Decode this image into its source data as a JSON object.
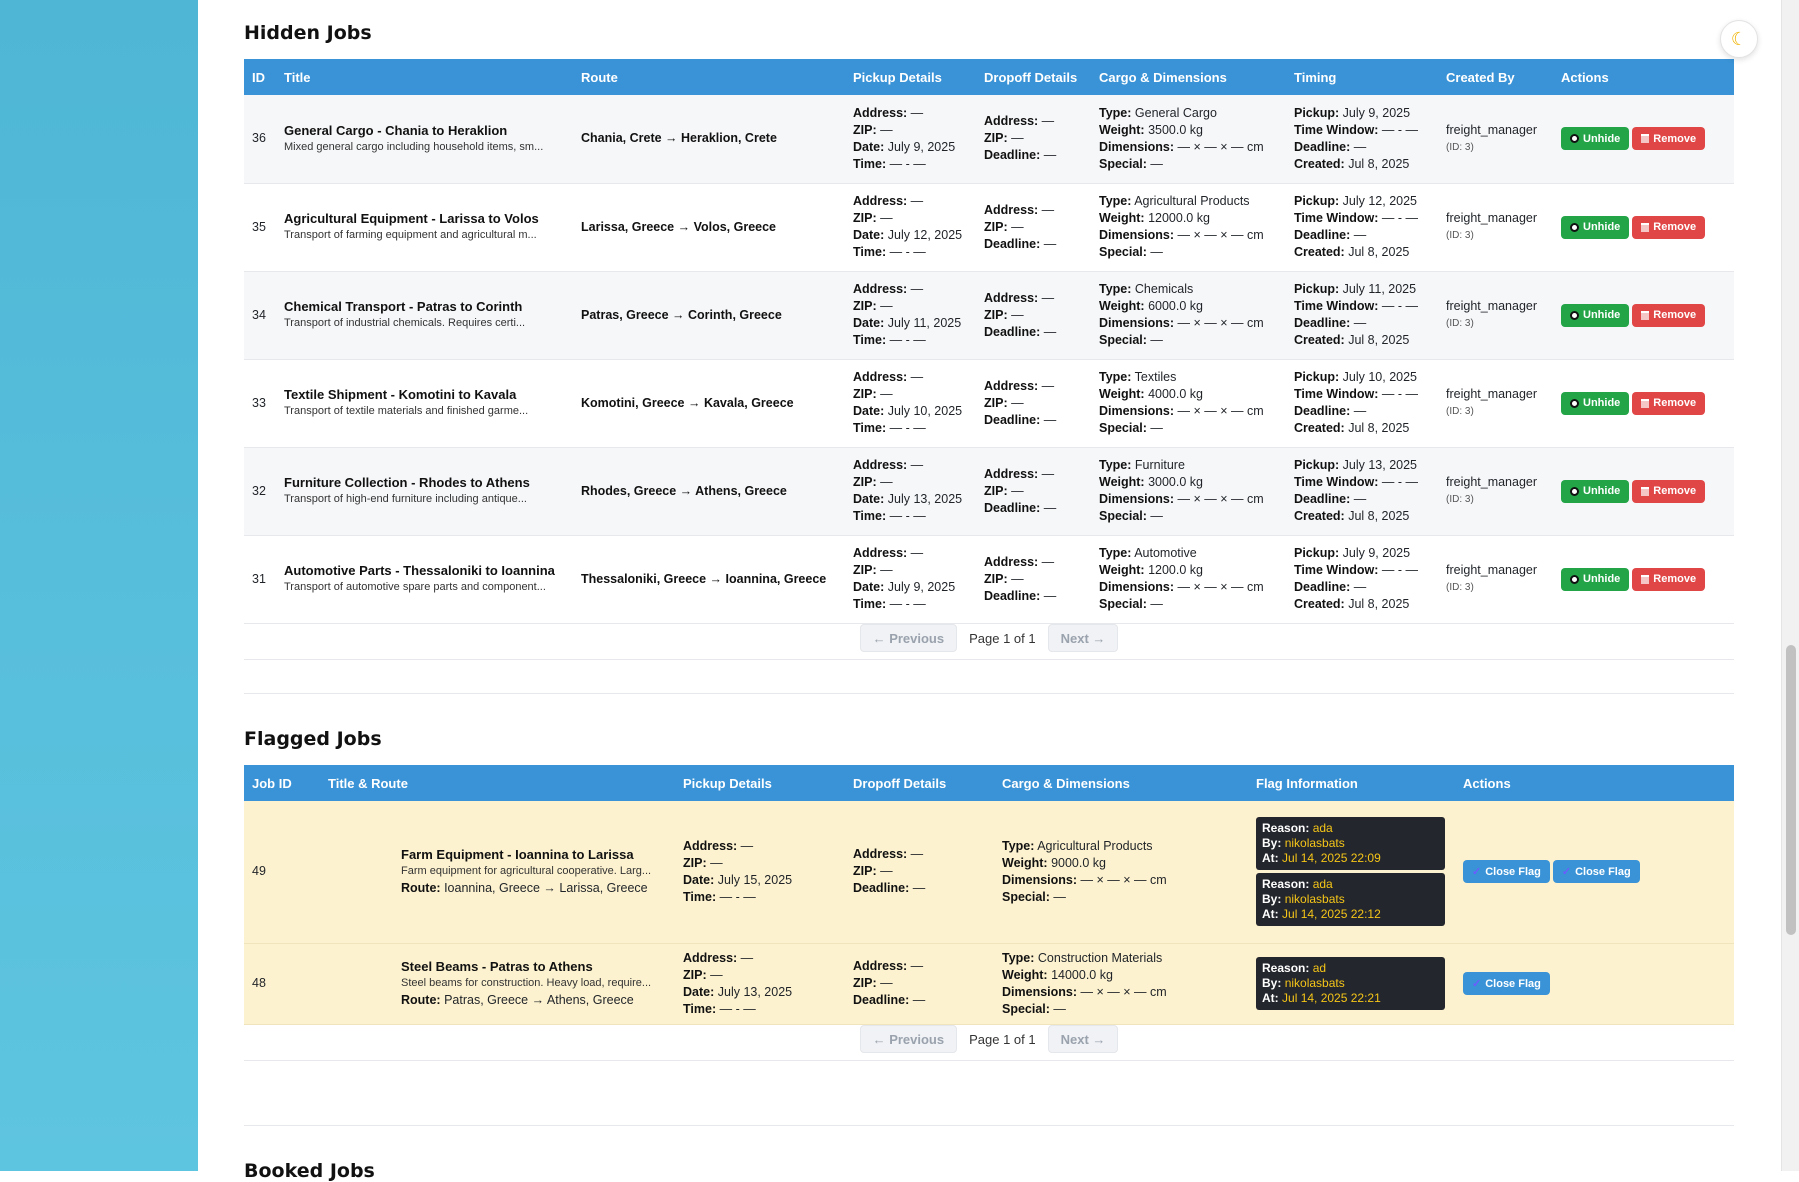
{
  "theme_toggle_icon": "moon-icon",
  "hidden_jobs": {
    "title": "Hidden Jobs",
    "columns": [
      "ID",
      "Title",
      "Route",
      "Pickup Details",
      "Dropoff Details",
      "Cargo & Dimensions",
      "Timing",
      "Created By",
      "Actions"
    ],
    "labels": {
      "address": "Address:",
      "zip": "ZIP:",
      "date": "Date:",
      "time": "Time:",
      "deadline": "Deadline:",
      "type": "Type:",
      "weight": "Weight:",
      "dimensions": "Dimensions:",
      "special": "Special:",
      "pickup": "Pickup:",
      "time_window": "Time Window:",
      "created": "Created:"
    },
    "rows": [
      {
        "id": "36",
        "title": "General Cargo - Chania to Heraklion",
        "desc": "Mixed general cargo including household items, sm...",
        "route": "Chania, Crete → Heraklion, Crete",
        "pickup": {
          "address": "—",
          "zip": "—",
          "date": "July 9, 2025",
          "time": "— - —"
        },
        "dropoff": {
          "address": "—",
          "zip": "—",
          "deadline": "—"
        },
        "cargo": {
          "type": "General Cargo",
          "weight": "3500.0 kg",
          "dimensions": "— × — × — cm",
          "special": "—"
        },
        "timing": {
          "pickup": "July 9, 2025",
          "time_window": "— - —",
          "deadline": "—",
          "created": "Jul 8, 2025"
        },
        "created_by": "freight_manager",
        "creator_id": "(ID: 3)"
      },
      {
        "id": "35",
        "title": "Agricultural Equipment - Larissa to Volos",
        "desc": "Transport of farming equipment and agricultural m...",
        "route": "Larissa, Greece → Volos, Greece",
        "pickup": {
          "address": "—",
          "zip": "—",
          "date": "July 12, 2025",
          "time": "— - —"
        },
        "dropoff": {
          "address": "—",
          "zip": "—",
          "deadline": "—"
        },
        "cargo": {
          "type": "Agricultural Products",
          "weight": "12000.0 kg",
          "dimensions": "— × — × — cm",
          "special": "—"
        },
        "timing": {
          "pickup": "July 12, 2025",
          "time_window": "— - —",
          "deadline": "—",
          "created": "Jul 8, 2025"
        },
        "created_by": "freight_manager",
        "creator_id": "(ID: 3)"
      },
      {
        "id": "34",
        "title": "Chemical Transport - Patras to Corinth",
        "desc": "Transport of industrial chemicals. Requires certi...",
        "route": "Patras, Greece → Corinth, Greece",
        "pickup": {
          "address": "—",
          "zip": "—",
          "date": "July 11, 2025",
          "time": "— - —"
        },
        "dropoff": {
          "address": "—",
          "zip": "—",
          "deadline": "—"
        },
        "cargo": {
          "type": "Chemicals",
          "weight": "6000.0 kg",
          "dimensions": "— × — × — cm",
          "special": "—"
        },
        "timing": {
          "pickup": "July 11, 2025",
          "time_window": "— - —",
          "deadline": "—",
          "created": "Jul 8, 2025"
        },
        "created_by": "freight_manager",
        "creator_id": "(ID: 3)"
      },
      {
        "id": "33",
        "title": "Textile Shipment - Komotini to Kavala",
        "desc": "Transport of textile materials and finished garme...",
        "route": "Komotini, Greece → Kavala, Greece",
        "pickup": {
          "address": "—",
          "zip": "—",
          "date": "July 10, 2025",
          "time": "— - —"
        },
        "dropoff": {
          "address": "—",
          "zip": "—",
          "deadline": "—"
        },
        "cargo": {
          "type": "Textiles",
          "weight": "4000.0 kg",
          "dimensions": "— × — × — cm",
          "special": "—"
        },
        "timing": {
          "pickup": "July 10, 2025",
          "time_window": "— - —",
          "deadline": "—",
          "created": "Jul 8, 2025"
        },
        "created_by": "freight_manager",
        "creator_id": "(ID: 3)"
      },
      {
        "id": "32",
        "title": "Furniture Collection - Rhodes to Athens",
        "desc": "Transport of high-end furniture including antique...",
        "route": "Rhodes, Greece → Athens, Greece",
        "pickup": {
          "address": "—",
          "zip": "—",
          "date": "July 13, 2025",
          "time": "— - —"
        },
        "dropoff": {
          "address": "—",
          "zip": "—",
          "deadline": "—"
        },
        "cargo": {
          "type": "Furniture",
          "weight": "3000.0 kg",
          "dimensions": "— × — × — cm",
          "special": "—"
        },
        "timing": {
          "pickup": "July 13, 2025",
          "time_window": "— - —",
          "deadline": "—",
          "created": "Jul 8, 2025"
        },
        "created_by": "freight_manager",
        "creator_id": "(ID: 3)"
      },
      {
        "id": "31",
        "title": "Automotive Parts - Thessaloniki to Ioannina",
        "desc": "Transport of automotive spare parts and component...",
        "route": "Thessaloniki, Greece → Ioannina, Greece",
        "pickup": {
          "address": "—",
          "zip": "—",
          "date": "July 9, 2025",
          "time": "— - —"
        },
        "dropoff": {
          "address": "—",
          "zip": "—",
          "deadline": "—"
        },
        "cargo": {
          "type": "Automotive",
          "weight": "1200.0 kg",
          "dimensions": "— × — × — cm",
          "special": "—"
        },
        "timing": {
          "pickup": "July 9, 2025",
          "time_window": "— - —",
          "deadline": "—",
          "created": "Jul 8, 2025"
        },
        "created_by": "freight_manager",
        "creator_id": "(ID: 3)"
      }
    ],
    "actions": {
      "unhide": "Unhide",
      "remove": "Remove",
      "unhide_icon": "eye-icon",
      "remove_icon": "trash-icon"
    },
    "pagination": {
      "previous": "← Previous",
      "info": "Page 1 of 1",
      "next": "Next →"
    }
  },
  "flagged_jobs": {
    "title": "Flagged Jobs",
    "columns": [
      "Job ID",
      "Title & Route",
      "Pickup Details",
      "Dropoff Details",
      "Cargo & Dimensions",
      "Flag Information",
      "Actions"
    ],
    "labels": {
      "route": "Route:",
      "reason": "Reason:",
      "by": "By:",
      "at": "At:"
    },
    "rows": [
      {
        "id": "49",
        "title": "Farm Equipment - Ioannina to Larissa",
        "desc": "Farm equipment for agricultural cooperative. Larg...",
        "route": "Ioannina, Greece → Larissa, Greece",
        "pickup": {
          "address": "—",
          "zip": "—",
          "date": "July 15, 2025",
          "time": "— - —"
        },
        "dropoff": {
          "address": "—",
          "zip": "—",
          "deadline": "—"
        },
        "cargo": {
          "type": "Agricultural Products",
          "weight": "9000.0 kg",
          "dimensions": "— × — × — cm",
          "special": "—"
        },
        "flags": [
          {
            "reason": "ada",
            "by": "nikolasbats",
            "at": "Jul 14, 2025 22:09"
          },
          {
            "reason": "ada",
            "by": "nikolasbats",
            "at": "Jul 14, 2025 22:12"
          }
        ]
      },
      {
        "id": "48",
        "title": "Steel Beams - Patras to Athens",
        "desc": "Steel beams for construction. Heavy load, require...",
        "route": "Patras, Greece → Athens, Greece",
        "pickup": {
          "address": "—",
          "zip": "—",
          "date": "July 13, 2025",
          "time": "— - —"
        },
        "dropoff": {
          "address": "—",
          "zip": "—",
          "deadline": "—"
        },
        "cargo": {
          "type": "Construction Materials",
          "weight": "14000.0 kg",
          "dimensions": "— × — × — cm",
          "special": "—"
        },
        "flags": [
          {
            "reason": "ad",
            "by": "nikolasbats",
            "at": "Jul 14, 2025 22:21"
          }
        ]
      }
    ],
    "actions": {
      "close_flag": "Close Flag",
      "close_flag_icon": "check-icon"
    },
    "pagination": {
      "previous": "← Previous",
      "info": "Page 1 of 1",
      "next": "Next →"
    }
  },
  "booked_jobs": {
    "title": "Booked Jobs"
  },
  "colors": {
    "header_blue": "#3a93d6",
    "unhide_green": "#22a447",
    "remove_red": "#e04646",
    "flag_row_bg": "#fdf2cf",
    "flag_box_bg": "#23262d",
    "flag_value": "#f5c518",
    "sidebar": "#4fb6d6"
  }
}
